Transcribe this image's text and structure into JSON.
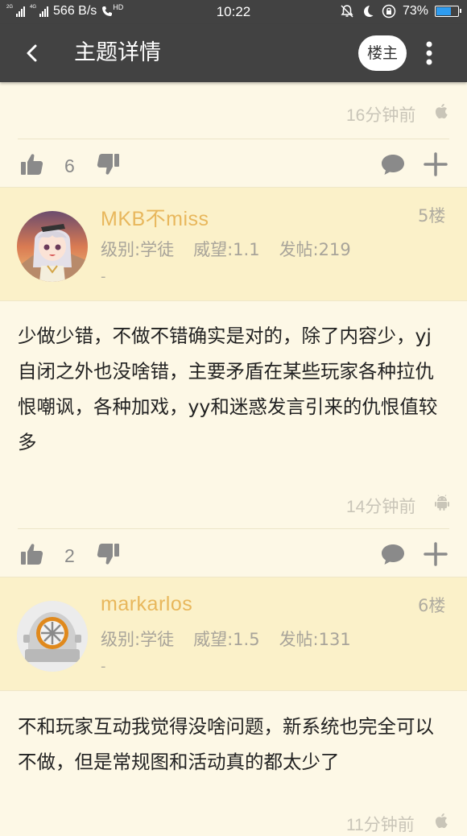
{
  "status_bar": {
    "network_left": "2G",
    "network_right": "4G",
    "speed": "566 B/s",
    "hd": "HD",
    "time": "10:22",
    "battery": "73%",
    "battery_level": 0.73,
    "battery_color": "#2e9cf0"
  },
  "app_bar": {
    "back_icon": "chevron-left-icon",
    "title": "主题详情",
    "owner_button": "楼主",
    "more_icon": "more-vertical-icon"
  },
  "post_top": {
    "time": "16分钟前",
    "platform_icon": "apple-icon",
    "like_count": "6"
  },
  "posts": [
    {
      "username": "MKB不miss",
      "floor": "5楼",
      "level": "级别:学徒",
      "prestige": "威望:1.1",
      "post_count": "发帖:219",
      "signature": "-",
      "body": "少做少错，不做不错确实是对的，除了内容少，yj自闭之外也没啥错，主要矛盾在某些玩家各种拉仇恨嘲讽，各种加戏，yy和迷惑发言引来的仇恨值较多",
      "time": "14分钟前",
      "platform_icon": "android-icon",
      "like_count": "2"
    },
    {
      "username": "markarlos",
      "floor": "6楼",
      "level": "级别:学徒",
      "prestige": "威望:1.5",
      "post_count": "发帖:131",
      "signature": "-",
      "body": "不和玩家互动我觉得没啥问题，新系统也完全可以不做，但是常规图和活动真的都太少了",
      "time": "11分钟前",
      "platform_icon": "apple-icon"
    }
  ],
  "colors": {
    "app_bar": "#424242",
    "page_background": "#fdf8e6",
    "user_band": "#fbf1c9",
    "username": "#e8b75c"
  }
}
